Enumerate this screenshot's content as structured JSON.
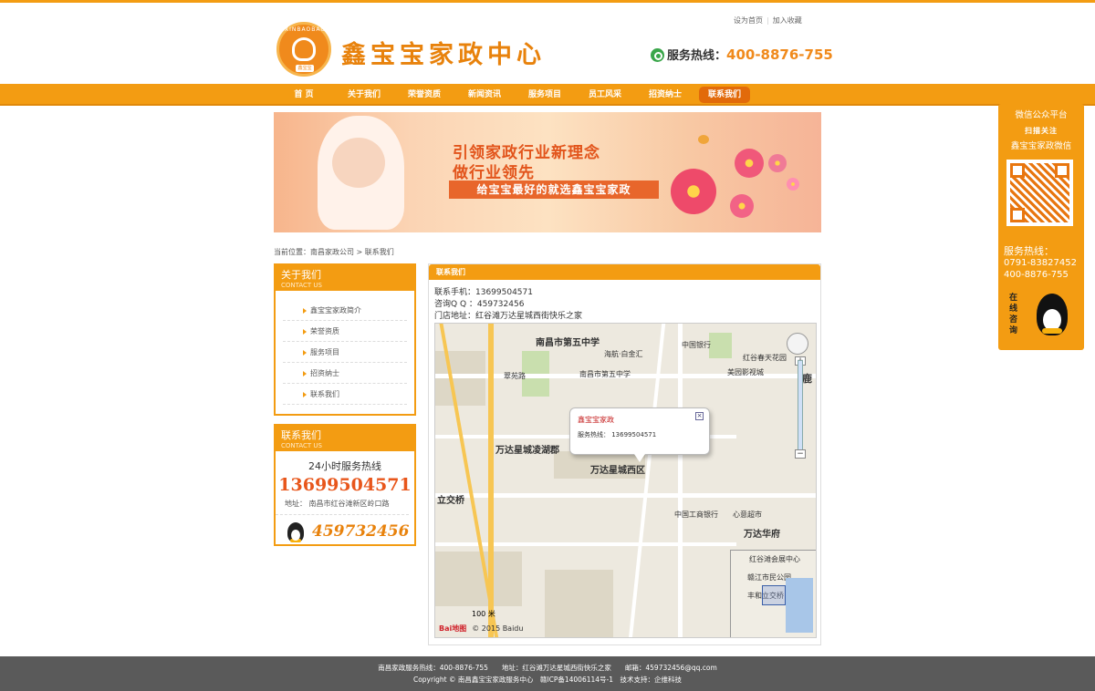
{
  "header": {
    "logo_text": "鑫宝宝家政中心",
    "logo_arc": "XINBAOBAO",
    "top_links": [
      "设为首页",
      "加入收藏"
    ],
    "hotline_label": "服务热线：",
    "hotline_number": "400-8876-755"
  },
  "nav": {
    "items": [
      "首 页",
      "关于我们",
      "荣誉资质",
      "新闻资讯",
      "服务项目",
      "员工风采",
      "招资纳士",
      "联系我们"
    ],
    "active": "联系我们"
  },
  "banner": {
    "line1": "引领家政行业新理念",
    "line2": "做行业领先",
    "line3": "给宝宝最好的就选鑫宝宝家政"
  },
  "breadcrumb": {
    "prefix": "当前位置：",
    "home": "南昌家政公司",
    "sep": ">",
    "current": "联系我们"
  },
  "about_box": {
    "title": "关于我们",
    "subtitle": "CONTACT US",
    "items": [
      "鑫宝宝家政简介",
      "荣誉资质",
      "服务项目",
      "招资纳士",
      "联系我们"
    ]
  },
  "contact_box": {
    "title": "联系我们",
    "subtitle": "CONTACT US",
    "service24": "24小时服务热线",
    "phone": "13699504571",
    "address": "地址：  南昌市红谷滩新区岭口路",
    "qq": "459732456"
  },
  "main": {
    "title": "联系我们",
    "mobile": "联系手机：13699504571",
    "qq": "咨询Q Q ：459732456",
    "address": "门店地址：红谷滩万达星城西街快乐之家"
  },
  "map": {
    "popup_title": "鑫宝宝家政",
    "popup_hotline": "服务热线：  13699504571",
    "popup_close": "×",
    "labels": {
      "school": "南昌市第五中学",
      "bank": "中国银行",
      "area1": "万达星城凌湖郡",
      "area2": "万达星城西区",
      "lijiao": "立交桥",
      "wanda": "万达华府",
      "icbc": "中国工商银行",
      "cuiyuan": "翠苑路",
      "shop": "海航·白金汇",
      "meizhou": "红谷春天花园",
      "nanchang5": "南昌市第五中学",
      "meiyuan": "美园影视城",
      "xinyuan": "心意超市",
      "ganjiang": "赣江市民公园",
      "fenghe": "丰和立交桥",
      "honggu": "红谷滩会展中心",
      "lu": "鹿",
      "scale": "100 米",
      "copyright": "© 2015 Baidu",
      "baidu": "Bai地图"
    }
  },
  "footer": {
    "line1": "南昌家政服务热线：400-8876-755　　地址：红谷滩万达星城西街快乐之家　　邮箱：459732456@qq.com",
    "line2": "Copyright © 南昌鑫宝宝家政服务中心　赣ICP备14006114号-1　技术支持：企维科技"
  },
  "float_panel": {
    "title": "微信公众平台",
    "sub": "扫描关注",
    "name": "鑫宝宝家政微信",
    "hotline_label": "服务热线：",
    "phone1": "0791-83827452",
    "phone2": "400-8876-755",
    "online": "在线咨询"
  },
  "colors": {
    "accent": "#f39c12",
    "active_nav": "#e26a0a",
    "phone_red": "#e8561b",
    "footer": "#5a5a5a"
  }
}
